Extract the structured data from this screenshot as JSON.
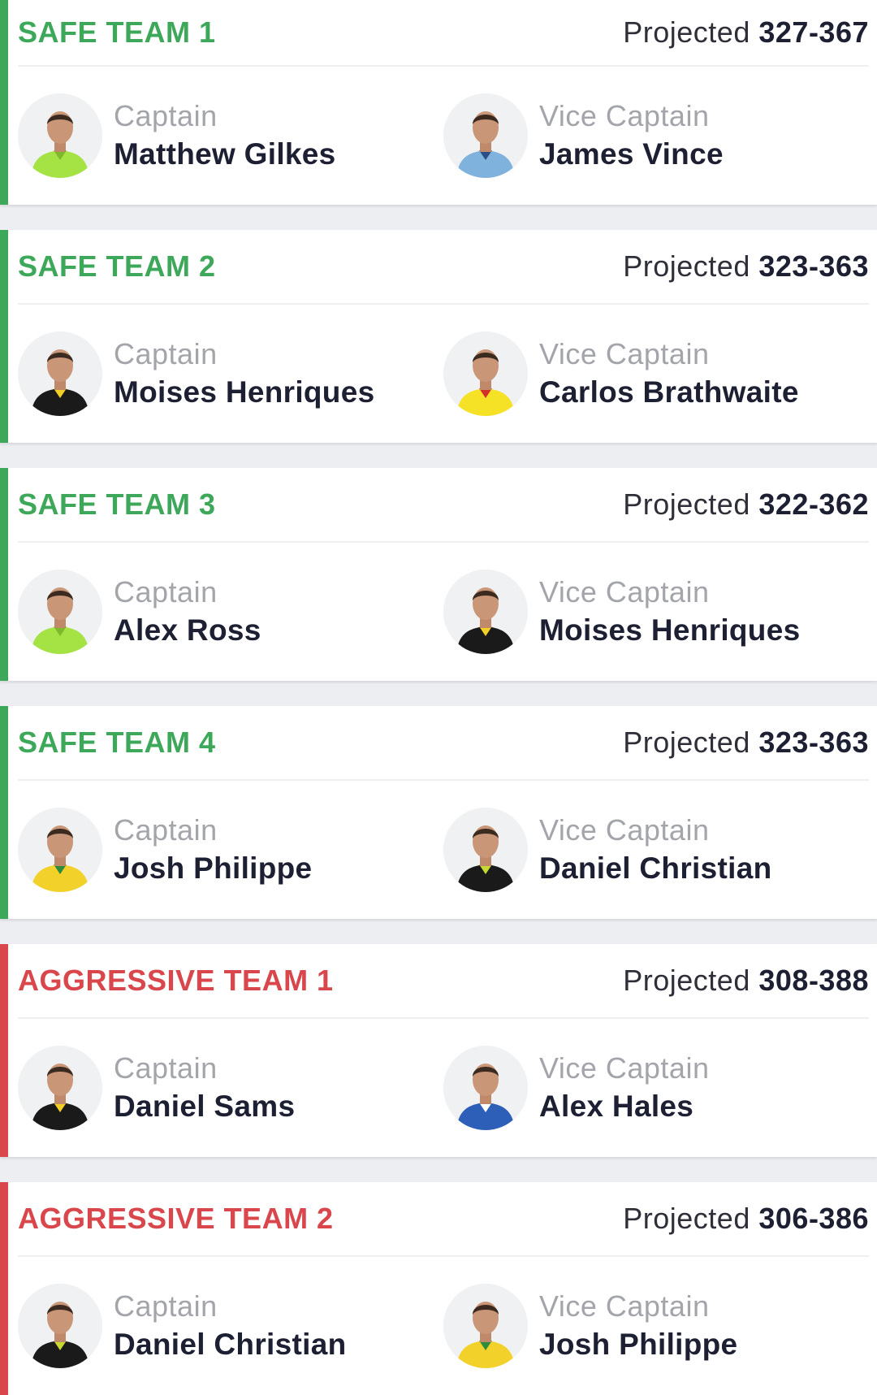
{
  "colors": {
    "safe": "#3ea85a",
    "aggressive": "#d9474c"
  },
  "teams": [
    {
      "name": "SAFE TEAM 1",
      "type": "safe",
      "projected_label": "Projected",
      "projected_range": "327-367",
      "captain": {
        "role": "Captain",
        "name": "Matthew Gilkes",
        "jersey": "#a5e244",
        "accent": "#7fb82c"
      },
      "vice_captain": {
        "role": "Vice Captain",
        "name": "James Vince",
        "jersey": "#7fb2dd",
        "accent": "#2a4f86"
      }
    },
    {
      "name": "SAFE TEAM 2",
      "type": "safe",
      "projected_label": "Projected",
      "projected_range": "323-363",
      "captain": {
        "role": "Captain",
        "name": "Moises Henriques",
        "jersey": "#1a1a1a",
        "accent": "#f2cf25"
      },
      "vice_captain": {
        "role": "Vice Captain",
        "name": "Carlos Brathwaite",
        "jersey": "#f5e226",
        "accent": "#d4312b"
      }
    },
    {
      "name": "SAFE TEAM 3",
      "type": "safe",
      "projected_label": "Projected",
      "projected_range": "322-362",
      "captain": {
        "role": "Captain",
        "name": "Alex Ross",
        "jersey": "#a5e244",
        "accent": "#7fb82c"
      },
      "vice_captain": {
        "role": "Vice Captain",
        "name": "Moises Henriques",
        "jersey": "#1a1a1a",
        "accent": "#f2cf25"
      }
    },
    {
      "name": "SAFE TEAM 4",
      "type": "safe",
      "projected_label": "Projected",
      "projected_range": "323-363",
      "captain": {
        "role": "Captain",
        "name": "Josh Philippe",
        "jersey": "#f2d22a",
        "accent": "#2e8a3d"
      },
      "vice_captain": {
        "role": "Vice Captain",
        "name": "Daniel Christian",
        "jersey": "#1a1a1a",
        "accent": "#c7d832"
      }
    },
    {
      "name": "AGGRESSIVE TEAM 1",
      "type": "aggressive",
      "projected_label": "Projected",
      "projected_range": "308-388",
      "captain": {
        "role": "Captain",
        "name": "Daniel Sams",
        "jersey": "#1a1a1a",
        "accent": "#f2cf25"
      },
      "vice_captain": {
        "role": "Vice Captain",
        "name": "Alex Hales",
        "jersey": "#2d5fb8",
        "accent": "#ffffff"
      }
    },
    {
      "name": "AGGRESSIVE TEAM 2",
      "type": "aggressive",
      "projected_label": "Projected",
      "projected_range": "306-386",
      "captain": {
        "role": "Captain",
        "name": "Daniel Christian",
        "jersey": "#1a1a1a",
        "accent": "#c7d832"
      },
      "vice_captain": {
        "role": "Vice Captain",
        "name": "Josh Philippe",
        "jersey": "#f2d22a",
        "accent": "#2e8a3d"
      }
    }
  ]
}
